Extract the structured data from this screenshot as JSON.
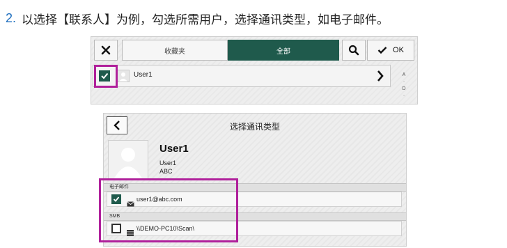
{
  "instruction": {
    "number": "2.",
    "text": "以选择【联系人】为例，勾选所需用户，选择通讯类型，如电子邮件。"
  },
  "contact_list": {
    "tabs": [
      {
        "label": "收藏夹",
        "active": false
      },
      {
        "label": "全部",
        "active": true
      }
    ],
    "ok_label": "OK",
    "rows": [
      {
        "name": "User1",
        "checked": true
      }
    ],
    "index_letters": [
      "A",
      "·",
      "D",
      "·"
    ]
  },
  "select_type": {
    "title": "选择通讯类型",
    "contact": {
      "name": "User1",
      "line1": "User1",
      "line2": "ABC"
    },
    "sections": [
      {
        "header": "电子邮件",
        "icon": "envelope-icon",
        "value": "user1@abc.com",
        "checked": true
      },
      {
        "header": "SMB",
        "icon": "server-icon",
        "value": "\\\\DEMO-PC10\\Scan\\",
        "checked": false
      }
    ]
  },
  "colors": {
    "accent": "#1f5a4c",
    "highlight": "#b0209b",
    "step_number": "#1f6fbf"
  }
}
